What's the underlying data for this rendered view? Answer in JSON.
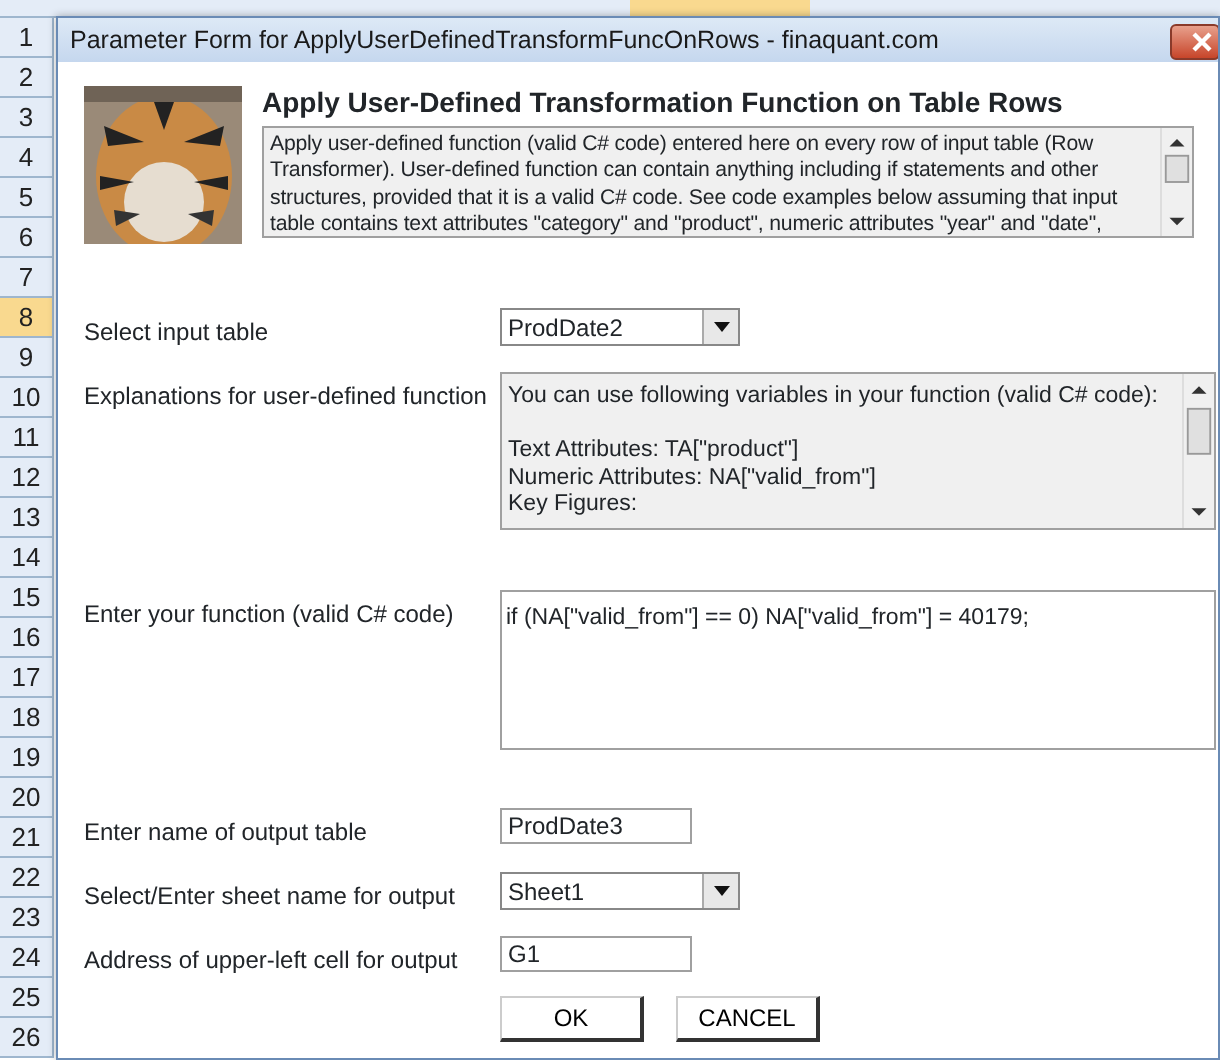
{
  "sheet": {
    "rows": [
      {
        "label": "1",
        "selected": false
      },
      {
        "label": "2",
        "selected": false
      },
      {
        "label": "3",
        "selected": false
      },
      {
        "label": "4",
        "selected": false
      },
      {
        "label": "5",
        "selected": false
      },
      {
        "label": "6",
        "selected": false
      },
      {
        "label": "7",
        "selected": false
      },
      {
        "label": "8",
        "selected": true
      },
      {
        "label": "9",
        "selected": false
      },
      {
        "label": "10",
        "selected": false
      },
      {
        "label": "11",
        "selected": false
      },
      {
        "label": "12",
        "selected": false
      },
      {
        "label": "13",
        "selected": false
      },
      {
        "label": "14",
        "selected": false
      },
      {
        "label": "15",
        "selected": false
      },
      {
        "label": "16",
        "selected": false
      },
      {
        "label": "17",
        "selected": false
      },
      {
        "label": "18",
        "selected": false
      },
      {
        "label": "19",
        "selected": false
      },
      {
        "label": "20",
        "selected": false
      },
      {
        "label": "21",
        "selected": false
      },
      {
        "label": "22",
        "selected": false
      },
      {
        "label": "23",
        "selected": false
      },
      {
        "label": "24",
        "selected": false
      },
      {
        "label": "25",
        "selected": false
      },
      {
        "label": "26",
        "selected": false
      }
    ]
  },
  "dialog": {
    "title": "Parameter Form for ApplyUserDefinedTransformFuncOnRows - finaquant.com",
    "header": {
      "heading": "Apply User-Defined Transformation Function on Table Rows",
      "description": "Apply user-defined function (valid C# code) entered here on every row of input table (Row Transformer). User-defined function can contain anything including if statements and other structures, provided that it is a valid C# code. See code examples below assuming that input table contains text attributes \"category\" and \"product\", numeric attributes \"year\" and \"date\","
    },
    "fields": [
      {
        "kind": "dropdown",
        "label": "Select input table",
        "value": "ProdDate2"
      },
      {
        "kind": "info",
        "label": "Explanations for user-defined function",
        "paragraphs": [
          [
            "You can use following variables in your function (valid C# code):"
          ],
          [
            "Text Attributes: TA[\"product\"]",
            "Numeric Attributes: NA[\"valid_from\"]",
            "Key Figures:"
          ]
        ]
      },
      {
        "kind": "code",
        "label": "Enter your function (valid C# code)",
        "value": "if (NA[\"valid_from\"] == 0) NA[\"valid_from\"] = 40179;"
      },
      {
        "kind": "text",
        "label": "Enter name of output table",
        "value": "ProdDate3"
      },
      {
        "kind": "dropdown",
        "label": "Select/Enter sheet name for output",
        "value": "Sheet1"
      },
      {
        "kind": "text",
        "label": "Address of upper-left cell for output",
        "value": "G1"
      }
    ],
    "buttons": [
      "OK",
      "CANCEL"
    ]
  }
}
